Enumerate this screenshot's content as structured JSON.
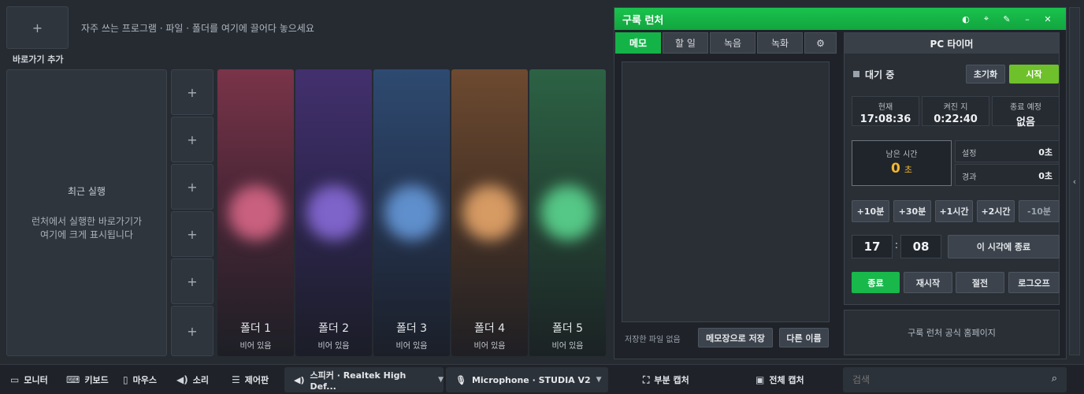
{
  "shortcut_bar": {
    "add_tile_icon": "plus-icon",
    "hint": "자주 쓰는 프로그램 · 파일 · 폴더를 여기에 끌어다 놓으세요",
    "add_label": "바로가기 추가"
  },
  "recent": {
    "title": "최근 실행",
    "desc_line1": "런처에서 실행한 바로가기가",
    "desc_line2": "여기에 크게 표시됩니다"
  },
  "slots": [
    "+",
    "+",
    "+",
    "+",
    "+",
    "+"
  ],
  "folders": [
    {
      "name": "폴더 1",
      "status": "비어 있음",
      "color": "#c9607f"
    },
    {
      "name": "폴더 2",
      "status": "비어 있음",
      "color": "#7e63c9"
    },
    {
      "name": "폴더 3",
      "status": "비어 있음",
      "color": "#5f8fcc"
    },
    {
      "name": "폴더 4",
      "status": "비어 있음",
      "color": "#d69a63"
    },
    {
      "name": "폴더 5",
      "status": "비어 있음",
      "color": "#55c786"
    }
  ],
  "launcher": {
    "title": "구룩 런처",
    "header_icons": [
      "theme-icon",
      "location-pin-icon",
      "pin-icon",
      "minimize-icon",
      "close-icon"
    ],
    "accent": "#14b348",
    "tabs": [
      "메모",
      "할 일",
      "녹음",
      "녹화"
    ],
    "settings_icon": "gear-icon",
    "memo": {
      "status": "저장한 파일 없음",
      "save_notepad": "메모장으로 저장",
      "save_as": "다른 이름"
    },
    "timer": {
      "title": "PC 타이머",
      "state": "대기 중",
      "reset": "초기화",
      "start": "시작",
      "now_label": "현재",
      "now_value": "17:08:36",
      "uptime_label": "켜진 지",
      "uptime_value": "0:22:40",
      "end_label": "종료 예정",
      "end_value": "없음",
      "remain_label": "남은 시간",
      "remain_value": "0",
      "remain_unit": "초",
      "set_label": "설정",
      "set_value": "0초",
      "elapsed_label": "경과",
      "elapsed_value": "0초",
      "quick": [
        "+10분",
        "+30분",
        "+1시간",
        "+2시간",
        "-10분"
      ],
      "hour": "17",
      "minute": "08",
      "colon": ":",
      "end_at": "이 시각에 종료",
      "actions": [
        "종료",
        "재시작",
        "절전",
        "로그오프"
      ]
    },
    "homepage": "구룩 런처 공식 홈페이지"
  },
  "taskbar": {
    "monitor": "모니터",
    "keyboard": "키보드",
    "mouse": "마우스",
    "sound": "소리",
    "control": "제어판",
    "speaker": "스피커 · Realtek High Def...",
    "mic": "Microphone · STUDIA V2",
    "partial_capture": "부분 캡처",
    "full_capture": "전체 캡처",
    "search_placeholder": "검색"
  }
}
